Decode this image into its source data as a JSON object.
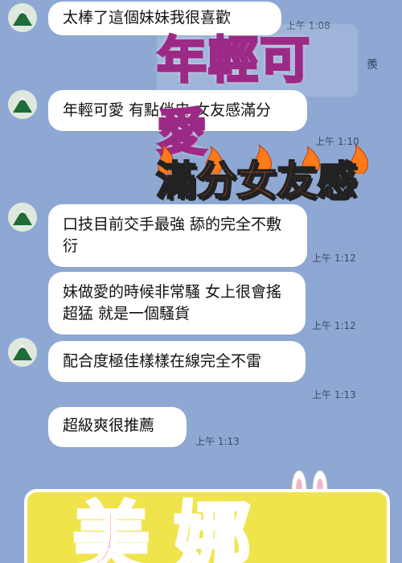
{
  "messages": [
    {
      "text": "太棒了這個妹妹我很喜歡",
      "time": "上午 1:08"
    },
    {
      "text": "年輕可愛 有點俏皮 女友感滿分",
      "time": "上午 1:10"
    },
    {
      "text": "口技目前交手最強 舔的完全不敷衍",
      "time": "上午 1:12"
    },
    {
      "text": "妹做愛的時候非常騷 女上很會搖超猛 就是一個騷貨",
      "time": "上午 1:12"
    },
    {
      "text": "配合度極佳樣樣在線完全不雷",
      "time": "上午 1:13"
    },
    {
      "text": "超級爽很推薦",
      "time": "上午 1:13"
    }
  ],
  "stickers": {
    "young_cute": "年輕可愛",
    "side_text": "羨",
    "full_girlfriend": "滿分女友感",
    "bottom_banner": "美娜"
  },
  "colors": {
    "background": "#8ea8d3",
    "bubble": "#ffffff",
    "accent_pink": "#f7a7d8",
    "accent_red": "#e82323"
  }
}
